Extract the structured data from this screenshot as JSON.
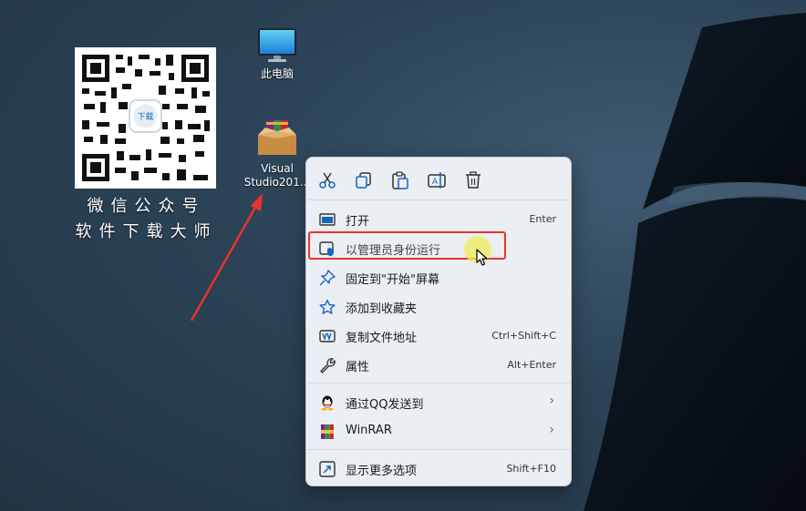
{
  "desktop": {
    "icons": [
      {
        "name": "此电脑",
        "icon": "monitor-icon"
      },
      {
        "name": "Visual\nStudio201...",
        "icon": "winrar-archive-icon"
      }
    ],
    "qr_caption_line1": "微信公众号",
    "qr_caption_line2": "软件下载大师",
    "qr_center_text": "下载"
  },
  "context_menu": {
    "toolbar": [
      {
        "name": "cut",
        "icon": "scissors-icon"
      },
      {
        "name": "copy",
        "icon": "copy-icon"
      },
      {
        "name": "paste",
        "icon": "paste-icon"
      },
      {
        "name": "rename",
        "icon": "rename-icon"
      },
      {
        "name": "delete",
        "icon": "trash-icon"
      }
    ],
    "items": [
      {
        "label": "打开",
        "shortcut": "Enter",
        "icon": "window-icon"
      },
      {
        "label": "以管理员身份运行",
        "shortcut": "",
        "icon": "shield-icon",
        "highlighted": true
      },
      {
        "label": "固定到\"开始\"屏幕",
        "shortcut": "",
        "icon": "pin-icon"
      },
      {
        "label": "添加到收藏夹",
        "shortcut": "",
        "icon": "star-icon"
      },
      {
        "label": "复制文件地址",
        "shortcut": "Ctrl+Shift+C",
        "icon": "path-icon"
      },
      {
        "label": "属性",
        "shortcut": "Alt+Enter",
        "icon": "wrench-icon"
      },
      {
        "label": "通过QQ发送到",
        "shortcut": "",
        "icon": "qq-icon",
        "submenu": true
      },
      {
        "label": "WinRAR",
        "shortcut": "",
        "icon": "winrar-icon",
        "submenu": true
      },
      {
        "label": "显示更多选项",
        "shortcut": "Shift+F10",
        "icon": "more-options-icon"
      }
    ]
  },
  "colors": {
    "highlight_box": "#e8332b",
    "arrow": "#e8332b",
    "menu_icon_blue": "#1565c0"
  }
}
